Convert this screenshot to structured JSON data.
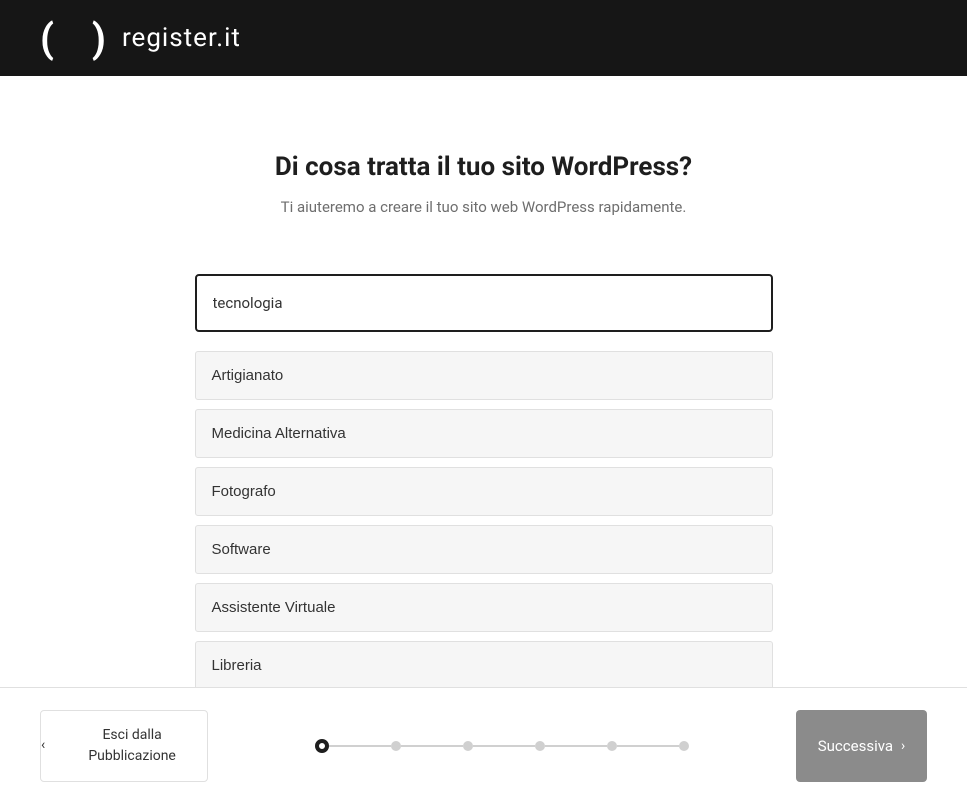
{
  "header": {
    "logo_text": "register.it"
  },
  "main": {
    "heading": "Di cosa tratta il tuo sito WordPress?",
    "subheading": "Ti aiuteremo a creare il tuo sito web WordPress rapidamente.",
    "search_value": "tecnologia",
    "options": [
      "Artigianato",
      "Medicina Alternativa",
      "Fotografo",
      "Software",
      "Assistente Virtuale",
      "Libreria"
    ]
  },
  "footer": {
    "back_label": "Esci dalla Pubblicazione",
    "next_label": "Successiva",
    "total_steps": 6,
    "current_step": 1
  }
}
